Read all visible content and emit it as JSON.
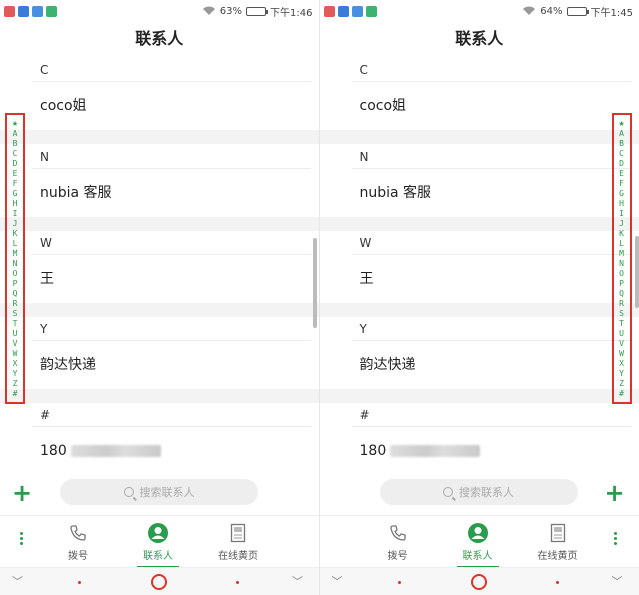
{
  "screens": [
    {
      "status": {
        "battery": "63%",
        "time": "下午1:46",
        "battery_level": 0.63
      },
      "title": "联系人",
      "sections": [
        {
          "header": "C",
          "contacts": [
            "coco姐"
          ]
        },
        {
          "header": "N",
          "contacts": [
            "nubia 客服"
          ]
        },
        {
          "header": "W",
          "contacts": [
            "王"
          ]
        },
        {
          "header": "Y",
          "contacts": [
            "韵达快递"
          ]
        },
        {
          "header": "#",
          "contacts": [
            "180"
          ]
        }
      ],
      "index_letters": [
        "★",
        "A",
        "B",
        "C",
        "D",
        "E",
        "F",
        "G",
        "H",
        "I",
        "J",
        "K",
        "L",
        "M",
        "N",
        "O",
        "P",
        "Q",
        "R",
        "S",
        "T",
        "U",
        "V",
        "W",
        "X",
        "Y",
        "Z",
        "#"
      ],
      "search_placeholder": "搜索联系人",
      "tabs": [
        {
          "label": "拨号"
        },
        {
          "label": "联系人"
        },
        {
          "label": "在线黄页"
        }
      ],
      "index_side": "left"
    },
    {
      "status": {
        "battery": "64%",
        "time": "下午1:45",
        "battery_level": 0.64
      },
      "title": "联系人",
      "sections": [
        {
          "header": "C",
          "contacts": [
            "coco姐"
          ]
        },
        {
          "header": "N",
          "contacts": [
            "nubia 客服"
          ]
        },
        {
          "header": "W",
          "contacts": [
            "王"
          ]
        },
        {
          "header": "Y",
          "contacts": [
            "韵达快递"
          ]
        },
        {
          "header": "#",
          "contacts": [
            "180"
          ]
        }
      ],
      "index_letters": [
        "★",
        "A",
        "B",
        "C",
        "D",
        "E",
        "F",
        "G",
        "H",
        "I",
        "J",
        "K",
        "L",
        "M",
        "N",
        "O",
        "P",
        "Q",
        "R",
        "S",
        "T",
        "U",
        "V",
        "W",
        "X",
        "Y",
        "Z",
        "#"
      ],
      "search_placeholder": "搜索联系人",
      "tabs": [
        {
          "label": "拨号"
        },
        {
          "label": "联系人"
        },
        {
          "label": "在线黄页"
        }
      ],
      "index_side": "right"
    }
  ],
  "colors": {
    "accent": "#2a9d4c",
    "highlight": "#d9342b"
  }
}
